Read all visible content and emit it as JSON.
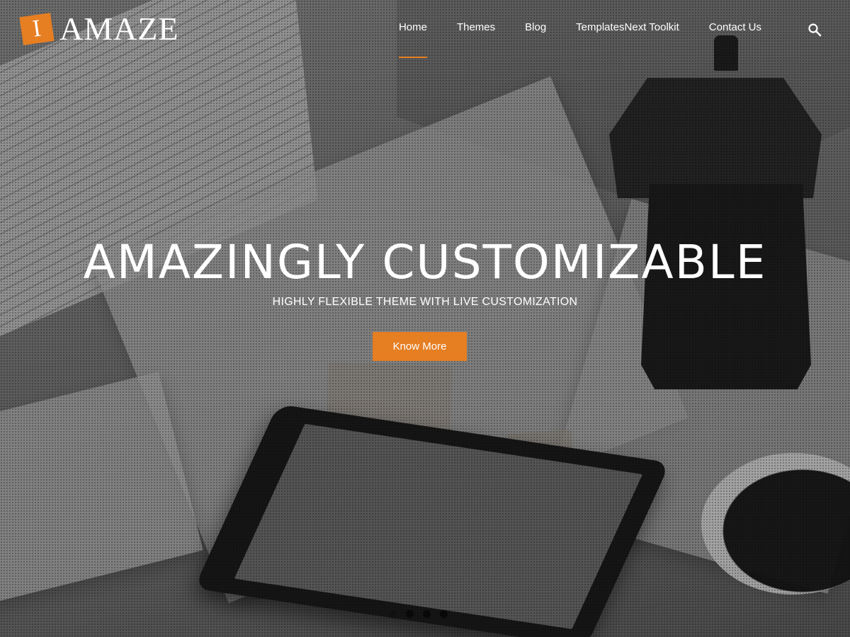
{
  "site": {
    "logo_mark": "I",
    "logo_text": "AMAZE"
  },
  "nav": {
    "items": [
      {
        "label": "Home",
        "active": true
      },
      {
        "label": "Themes",
        "active": false
      },
      {
        "label": "Blog",
        "active": false
      },
      {
        "label": "TemplatesNext Toolkit",
        "active": false
      },
      {
        "label": "Contact Us",
        "active": false
      }
    ],
    "search_icon": "search-icon"
  },
  "hero": {
    "title": "AMAZINGLY CUSTOMIZABLE",
    "subtitle": "HIGHLY FLEXIBLE THEME WITH LIVE CUSTOMIZATION",
    "cta_label": "Know More",
    "slides": 4,
    "active_slide": 1
  },
  "colors": {
    "accent": "#e67e22",
    "text": "#ffffff"
  }
}
